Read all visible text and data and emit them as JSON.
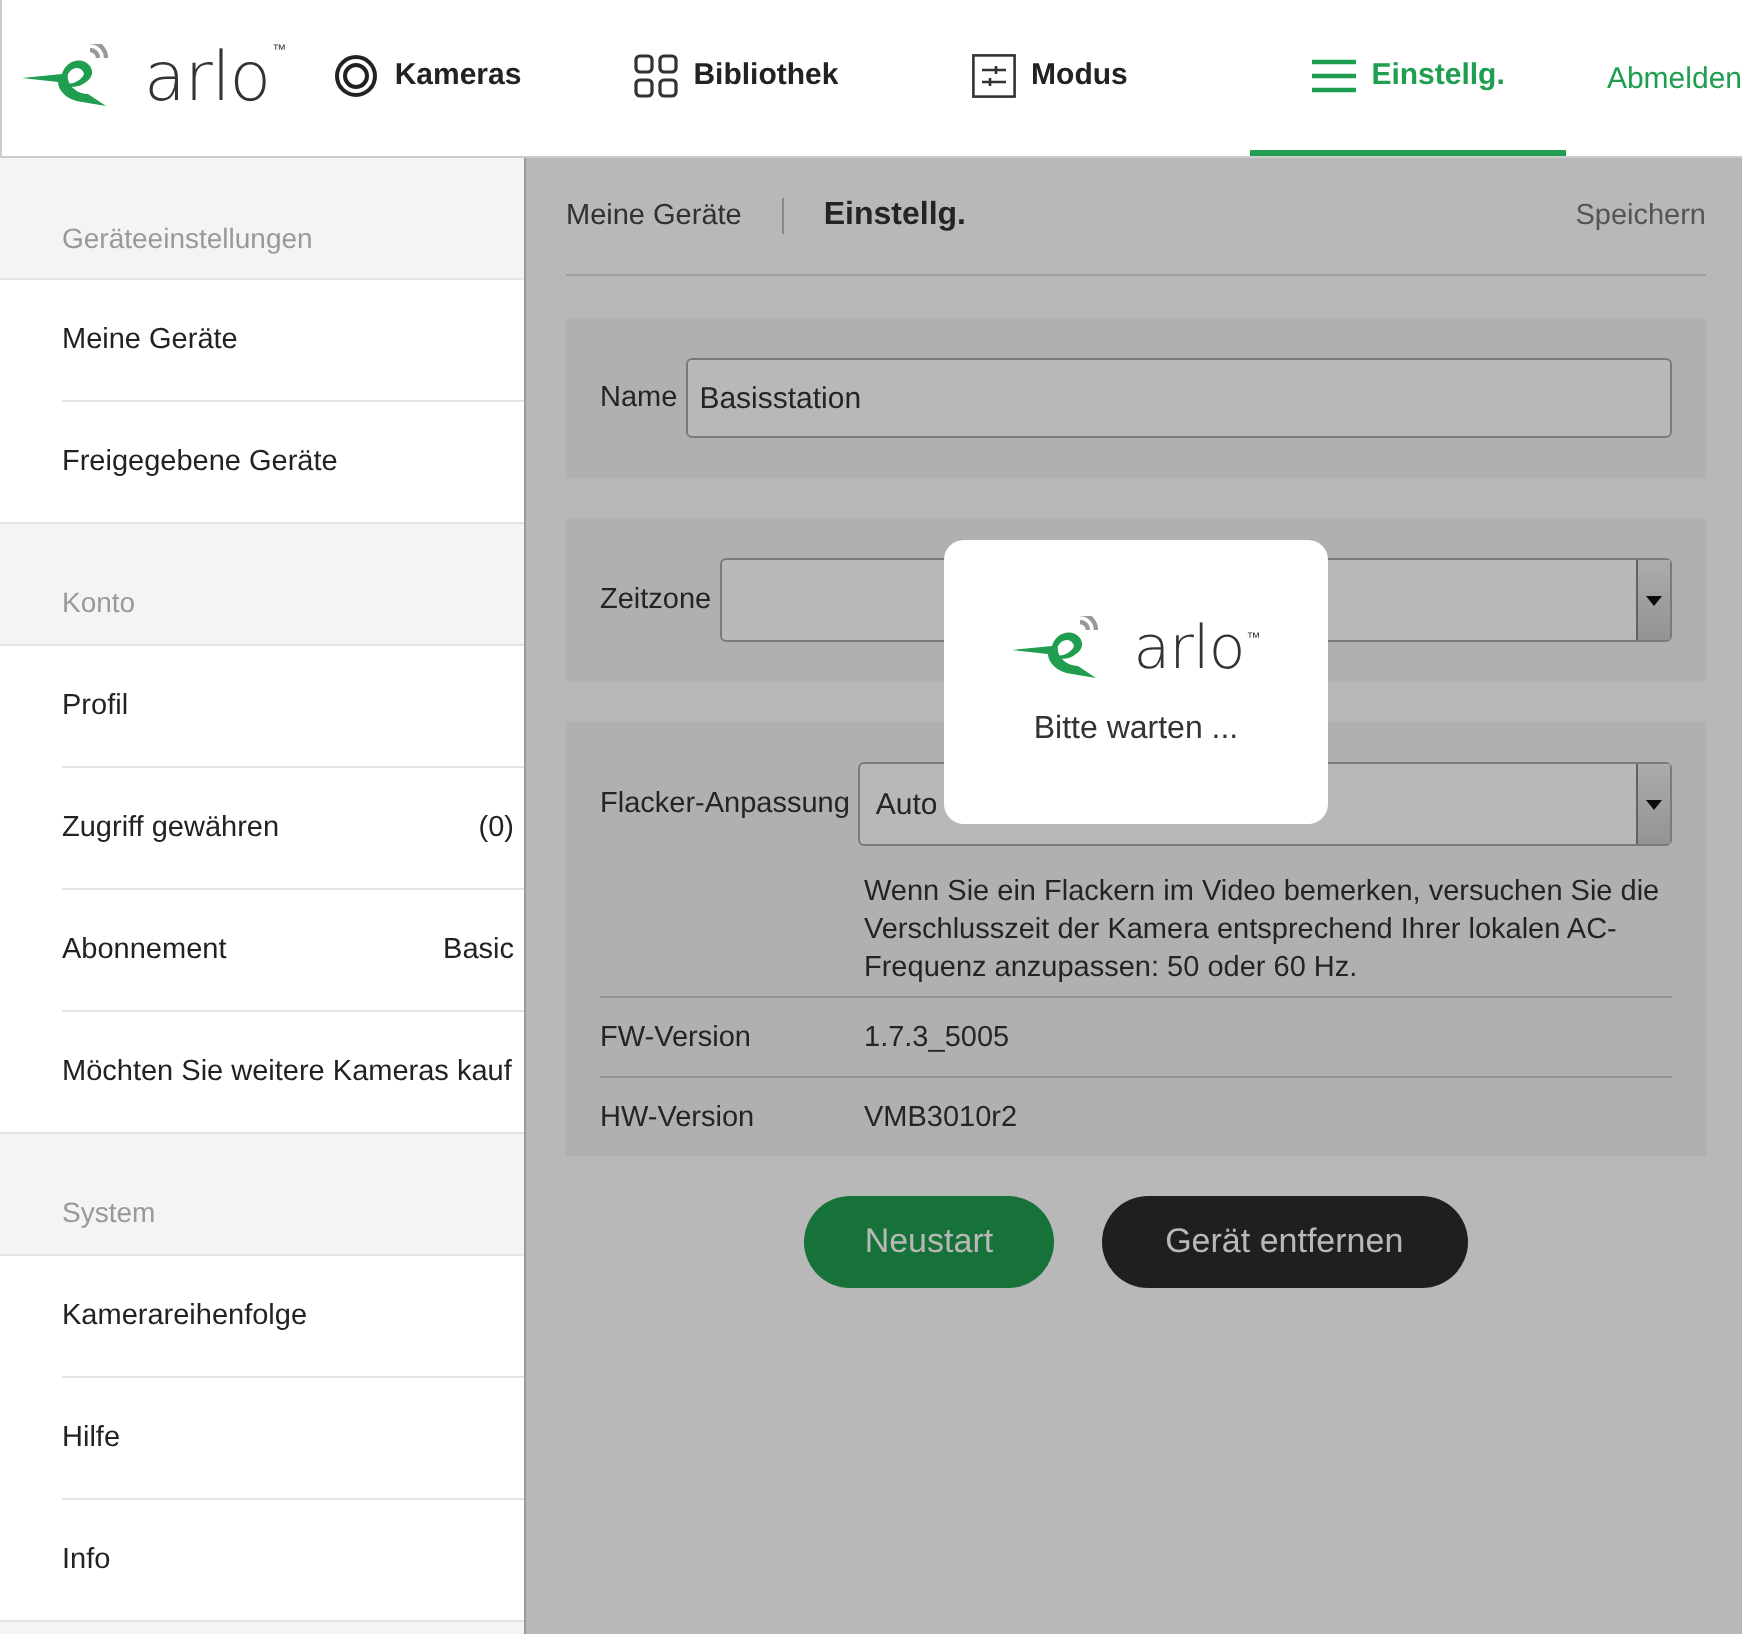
{
  "header": {
    "logo": {
      "wordmark": "arlo",
      "tm": "™"
    },
    "tabs": [
      {
        "label": "Kameras",
        "selected": false
      },
      {
        "label": "Bibliothek",
        "selected": false
      },
      {
        "label": "Modus",
        "selected": false
      },
      {
        "label": "Einstellg.",
        "selected": true
      }
    ],
    "logout": "Abmelden"
  },
  "sidebar": [
    {
      "title": "Geräteeinstellungen",
      "items": [
        {
          "label": "Meine Geräte"
        },
        {
          "label": "Freigegebene Geräte"
        }
      ]
    },
    {
      "title": "Konto",
      "items": [
        {
          "label": "Profil"
        },
        {
          "label": "Zugriff gewähren",
          "value": "(0)"
        },
        {
          "label": "Abonnement",
          "value": "Basic"
        },
        {
          "label": "Möchten Sie weitere Kameras kauf"
        }
      ]
    },
    {
      "title": "System",
      "items": [
        {
          "label": "Kamerareihenfolge"
        },
        {
          "label": "Hilfe"
        },
        {
          "label": "Info"
        }
      ]
    }
  ],
  "breadcrumb": {
    "parent": "Meine Geräte",
    "current": "Einstellg.",
    "save": "Speichern"
  },
  "name_field": {
    "label": "Name",
    "value": "Basisstation"
  },
  "timezone": {
    "label": "Zeitzone"
  },
  "flicker": {
    "label": "Flacker-Anpassung",
    "value": "Auto",
    "hint": "Wenn Sie ein Flackern im Video bemerken, versuchen Sie die Verschlusszeit der Kamera entsprechend Ihrer lokalen AC-Frequenz anzupassen: 50 oder 60 Hz."
  },
  "info_rows": [
    {
      "label": "FW-Version",
      "value": "1.7.3_5005"
    },
    {
      "label": "HW-Version",
      "value": "VMB3010r2"
    }
  ],
  "buttons": [
    {
      "label": "Neustart",
      "kind": "primary"
    },
    {
      "label": "Gerät entfernen",
      "kind": "dark"
    }
  ],
  "dialog": {
    "logo": {
      "wordmark": "arlo",
      "tm": "™"
    },
    "message": "Bitte warten ..."
  }
}
